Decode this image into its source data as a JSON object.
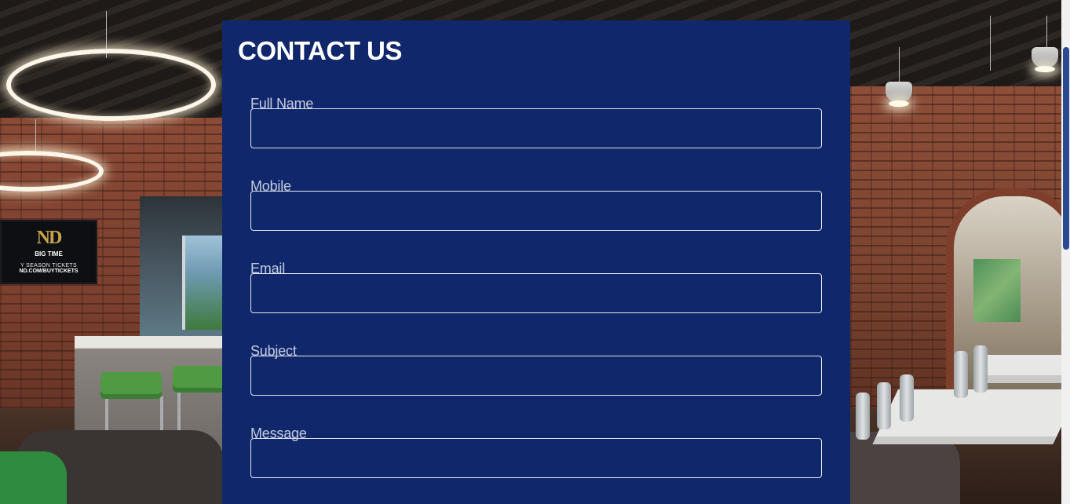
{
  "contact": {
    "title": "CONTACT US",
    "fields": [
      {
        "label": "Full Name",
        "value": "",
        "placeholder": ""
      },
      {
        "label": "Mobile",
        "value": "",
        "placeholder": ""
      },
      {
        "label": "Email",
        "value": "",
        "placeholder": ""
      },
      {
        "label": "Subject",
        "value": "",
        "placeholder": ""
      },
      {
        "label": "Message",
        "value": "",
        "placeholder": ""
      }
    ]
  },
  "background": {
    "tv_screen": {
      "logo": "ND",
      "line1": "BIG TIME",
      "line2": "Y SEASON TICKETS",
      "line3": "ND.COM/BUYTICKETS"
    }
  },
  "colors": {
    "card_background": "#10286b",
    "title_text": "#ffffff",
    "label_text": "#c3cbdf",
    "input_border": "#e4e8f2",
    "scrollbar_thumb": "#2c4a8f"
  }
}
